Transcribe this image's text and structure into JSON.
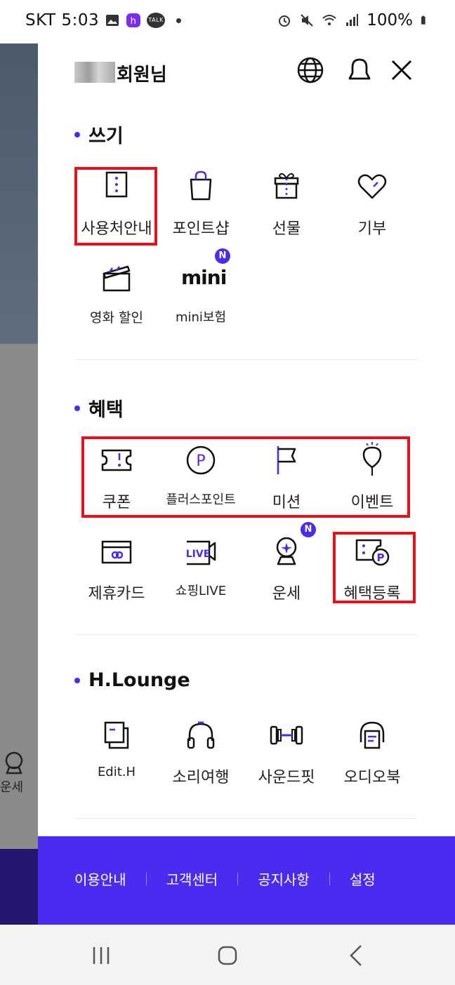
{
  "status_bar": {
    "carrier": "SKT",
    "time": "5:03",
    "talk_label": "TALK",
    "battery": "100%",
    "icons": [
      "gallery-icon",
      "h-app-icon",
      "kakaotalk-icon",
      "notification-dot",
      "alarm-icon",
      "mute-icon",
      "wifi-icon",
      "signal-icon",
      "battery-icon"
    ]
  },
  "background": {
    "fortune_label": "운세"
  },
  "header": {
    "member_label": "회원님",
    "icons": [
      "globe-icon",
      "bell-icon",
      "close-icon"
    ]
  },
  "sections": {
    "use": {
      "title": "쓰기",
      "items": [
        {
          "label": "사용처안내",
          "icon": "store-guide-icon"
        },
        {
          "label": "포인트샵",
          "icon": "shopping-bag-icon"
        },
        {
          "label": "선물",
          "icon": "gift-icon"
        },
        {
          "label": "기부",
          "icon": "heart-icon"
        },
        {
          "label": "영화 할인",
          "icon": "clapperboard-icon"
        },
        {
          "label": "mini보험",
          "icon": "mini-logo-icon",
          "logo_text": "mini",
          "badge": "N"
        }
      ]
    },
    "benefit": {
      "title": "혜택",
      "items": [
        {
          "label": "쿠폰",
          "icon": "coupon-icon"
        },
        {
          "label": "플러스포인트",
          "icon": "point-icon",
          "logo_text": "P"
        },
        {
          "label": "미션",
          "icon": "flag-icon"
        },
        {
          "label": "이벤트",
          "icon": "balloon-icon"
        },
        {
          "label": "제휴카드",
          "icon": "card-icon"
        },
        {
          "label": "쇼핑LIVE",
          "icon": "live-camera-icon",
          "logo_text": "LIVE"
        },
        {
          "label": "운세",
          "icon": "crystal-ball-icon",
          "badge": "N"
        },
        {
          "label": "혜택등록",
          "icon": "benefit-register-icon",
          "logo_text": "P"
        }
      ]
    },
    "lounge": {
      "title": "H.Lounge",
      "items": [
        {
          "label": "Edit.H",
          "icon": "edit-h-icon"
        },
        {
          "label": "소리여행",
          "icon": "headphones-icon"
        },
        {
          "label": "사운드핏",
          "icon": "dumbbell-icon"
        },
        {
          "label": "오디오북",
          "icon": "audiobook-icon"
        }
      ]
    }
  },
  "footer": {
    "links": [
      "이용안내",
      "고객센터",
      "공지사항",
      "설정"
    ]
  },
  "nav_bar": {
    "buttons": [
      "recent-apps-icon",
      "home-icon",
      "back-icon"
    ]
  },
  "colors": {
    "accent": "#4a2cf0",
    "highlight_border": "#e8101a",
    "text": "#111111"
  }
}
